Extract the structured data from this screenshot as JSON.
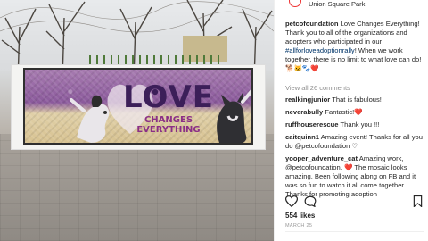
{
  "post": {
    "location": "Union Square Park",
    "caption": {
      "username": "petcofoundation",
      "text_1": "Love Changes Everything! Thank you to all of the organizations and adopters who participated in our",
      "hashtag": "#allforloveadoptionrally",
      "text_2": "! When we work together, there is no limit to what love can do! 🐕🐱🐾❤️"
    },
    "view_all_comments": "View all 26 comments",
    "comments": [
      {
        "user": "realkingjunior",
        "text": "That is fabulous!"
      },
      {
        "user": "neverabully",
        "text": "Fantastic!❤️"
      },
      {
        "user": "ruffhouserescue",
        "text": "Thank you !!!"
      },
      {
        "user": "caitquinn1",
        "text": "Amazing event! Thanks for all you do @petcofoundation ♡"
      },
      {
        "user": "yooper_adventure_cat",
        "text": "Amazing work, @petcofoundation. ❤️ The mosaic looks amazing. Been following along on FB and it was so fun to watch it all come together. Thanks for promoting adoption"
      }
    ],
    "likes": "554 likes",
    "date": "MARCH 25"
  },
  "mural": {
    "line1": "LOVE",
    "line2": "CHANGES",
    "line3": "EVERYTHING"
  },
  "colors": {
    "text": "#262626",
    "secondary": "#8e8e8e",
    "mural_purple": "#8b5a9c",
    "mural_gold": "#d7c291"
  },
  "icons": [
    "heart-icon",
    "comment-icon",
    "bookmark-icon",
    "paw-icon"
  ]
}
